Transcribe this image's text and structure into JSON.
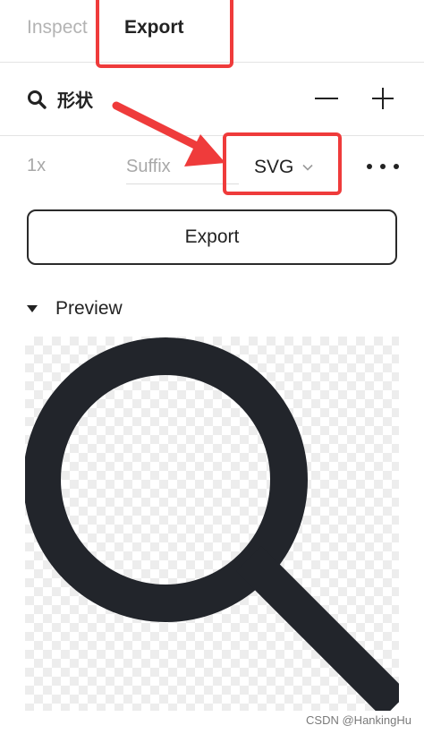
{
  "tabs": {
    "inspect": "Inspect",
    "export": "Export"
  },
  "layer": {
    "name": "形状",
    "icon": "search-icon",
    "minus": "−",
    "plus": "+"
  },
  "export_settings": {
    "scale": "1x",
    "suffix_placeholder": "Suffix",
    "suffix_value": "",
    "format": "SVG"
  },
  "export_button": "Export",
  "preview": {
    "label": "Preview",
    "icon": "magnifier-icon"
  },
  "colors": {
    "highlight": "#ef3b3b",
    "icon": "#22252b",
    "checker": "#ededed"
  },
  "watermark": "CSDN @HankingHu"
}
